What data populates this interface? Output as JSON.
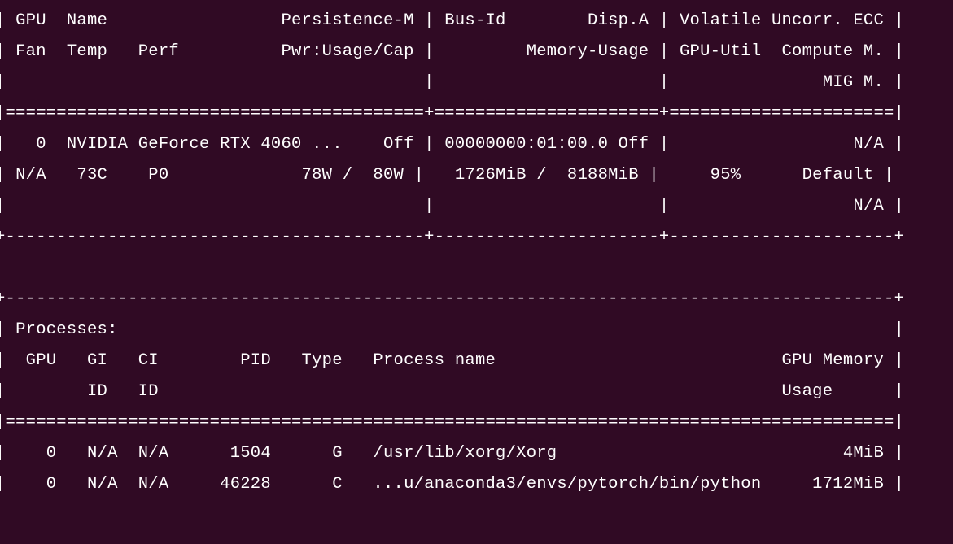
{
  "terminal": {
    "background": "#300a24",
    "foreground": "#ffffff",
    "lines": [
      "+-----------------------------------------+----------------------+----------------------+",
      "| GPU  Name                 Persistence-M | Bus-Id        Disp.A | Volatile Uncorr. ECC |",
      "| Fan  Temp   Perf          Pwr:Usage/Cap |         Memory-Usage | GPU-Util  Compute M. |",
      "|                                         |                      |               MIG M. |",
      "|=========================================+======================+======================|",
      "|   0  NVIDIA GeForce RTX 4060 ...    Off | 00000000:01:00.0 Off |                  N/A |",
      "| N/A   73C    P0             78W /  80W |   1726MiB /  8188MiB |     95%      Default |",
      "|                                         |                      |                  N/A |",
      "+-----------------------------------------+----------------------+----------------------+",
      "",
      "+---------------------------------------------------------------------------------------+",
      "| Processes:                                                                            |",
      "|  GPU   GI   CI        PID   Type   Process name                            GPU Memory |",
      "|        ID   ID                                                             Usage      |",
      "|=======================================================================================|",
      "|    0   N/A  N/A      1504      G   /usr/lib/xorg/Xorg                            4MiB |",
      "|    0   N/A  N/A     46228      C   ...u/anaconda3/envs/pytorch/bin/python     1712MiB |"
    ]
  }
}
